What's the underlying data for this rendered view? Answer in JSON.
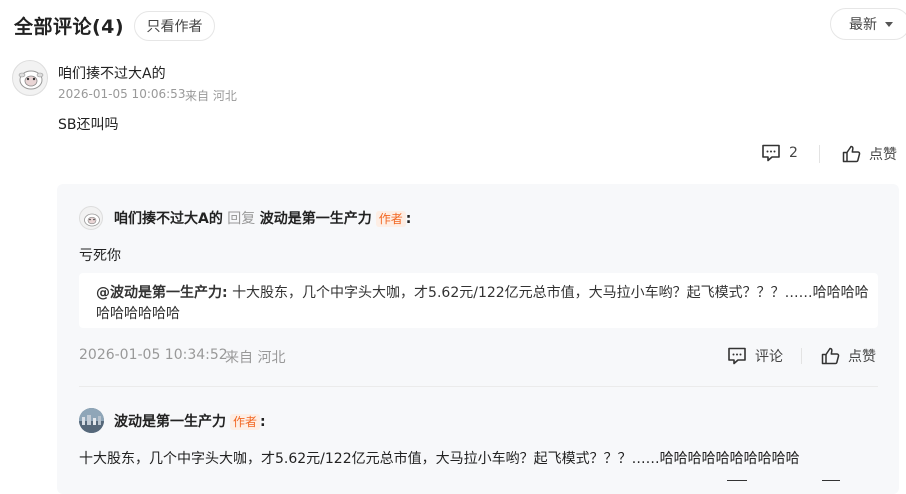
{
  "header": {
    "title": "全部评论(4)",
    "filter_label": "只看作者",
    "sort_label": "最新"
  },
  "comment": {
    "author": "咱们揍不过大A的",
    "timestamp": "2026-01-05 10:06:53",
    "location": "来自 河北",
    "text": "SB还叫吗",
    "reply_count": "2",
    "like_label": "点赞"
  },
  "replies": [
    {
      "author": "咱们揍不过大A的",
      "reply_word": "回复",
      "target": "波动是第一生产力",
      "target_tag": "作者",
      "text": "亏死你",
      "quote_name": "@波动是第一生产力:",
      "quote_text": "十大股东，几个中字头大咖，才5.62元/122亿元总市值，大马拉小车哟？起飞模式？？？……哈哈哈哈哈哈哈哈哈哈",
      "timestamp": "2026-01-05 10:34:52",
      "location": "来自 河北",
      "comment_label": "评论",
      "like_label": "点赞"
    },
    {
      "author": "波动是第一生产力",
      "author_tag": "作者",
      "text": "十大股东，几个中字头大咖，才5.62元/122亿元总市值，大马拉小车哟？起飞模式？？？……哈哈哈哈哈哈哈哈哈哈"
    }
  ],
  "icons": [
    "comment-icon",
    "thumbs-up-icon",
    "chevron-down-icon"
  ],
  "colors": {
    "author_tag": "#f26722",
    "panel_bg": "#f7f8fa"
  }
}
